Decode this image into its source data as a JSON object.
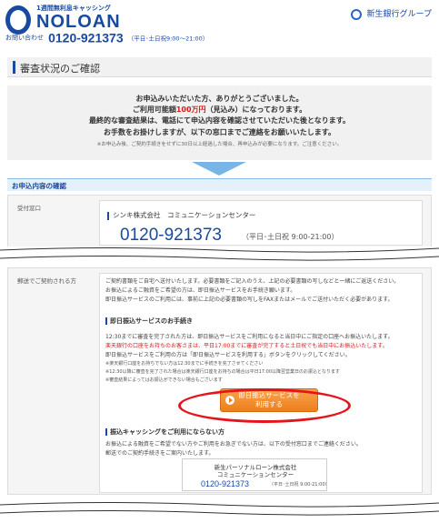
{
  "header": {
    "tagline": "1週間無利息キャッシング",
    "brand": "NOLOAN",
    "contact_label": "お問い合わせ",
    "contact_phone": "0120-921373",
    "contact_hours": "（平日･土日祝9:00〜21:00）",
    "group_name": "新生銀行グループ"
  },
  "page_title": "審査状況のご確認",
  "message": {
    "line1": "お申込みいただいた方、ありがとうございました。",
    "line2_pre": "ご利用可能額",
    "line2_amount": "100万円",
    "line2_post": "（見込み）になっております。",
    "line3": "最終的な審査結果は、電話にて申込内容を確認させていただいた後となります。",
    "line4": "お手数をお掛けしますが、以下の窓口までご連絡をお願いいたします。",
    "note": "※お申込み後、ご契約手続きをせずに30日以上経過した場合、再申込みが必要になります。ご注意ください。"
  },
  "section_title": "お申込内容の確認",
  "row1": {
    "label": "受付窓口",
    "company": "シンキ株式会社　コミュニケーションセンター",
    "phone": "0120-921373",
    "hours": "（平日･土日祝 9:00-21:00）"
  },
  "row2": {
    "label": "郵送でご契約される方",
    "intro1": "ご契約書類をご自宅へ送付いたします。必要書類をご記入のうえ、上記の必要書類の写しなどと一緒にご返送ください。",
    "intro2": "お振込によるご融資をご希望の方は、即日振込サービスをお手続き願います。",
    "intro3": "即日振込サービスのご利用には、事前に上記の必要書類の写しをFAXまたはメールでご送付いただく必要があります。",
    "sub1_title": "即日振込サービスのお手続き",
    "s1": "12:30までに審査を完了された方は、即日振込サービスをご利用になると当日中にご指定の口座へお振込いたします。",
    "s2": "楽天銀行の口座をお持ちのお客さまは、平日17:00までに審査が完了すると土日祝でも当日中にお振込いたします。",
    "s3": "即日振込サービスをご利用の方は「即日振込サービスを利用する」ボタンをクリックしてください。",
    "n1": "※楽天銀行口座をお持ちでない方は12:30までに手続きを完了させてください",
    "n2": "※12:30以降に審査を完了された場合は楽天銀行口座をお持ちの場合は平日17:00以降翌営業日のお振込となります",
    "n3": "※審査結果によってはお振込ができない場合もございます",
    "button_line1": "即日振込サービスを",
    "button_line2": "利用する",
    "sub2_title": "振込キャッシングをご利用にならない方",
    "t1": "お振込による融資をご希望でない方やご利用をお急ぎでない方は、以下の受付窓口までご連絡ください。",
    "t2": "郵送でのご契約手続きをご案内いたします。",
    "card_line1": "新生パーソナルローン株式会社",
    "card_line2": "コミュニケーションセンター",
    "card_phone": "0120-921373",
    "card_hours": "（平日･土日祝 9:00-21:00）"
  },
  "colors": {
    "brand_blue": "#1a4aa0",
    "accent_red": "#d8191b",
    "button_orange": "#ee7f1c"
  }
}
